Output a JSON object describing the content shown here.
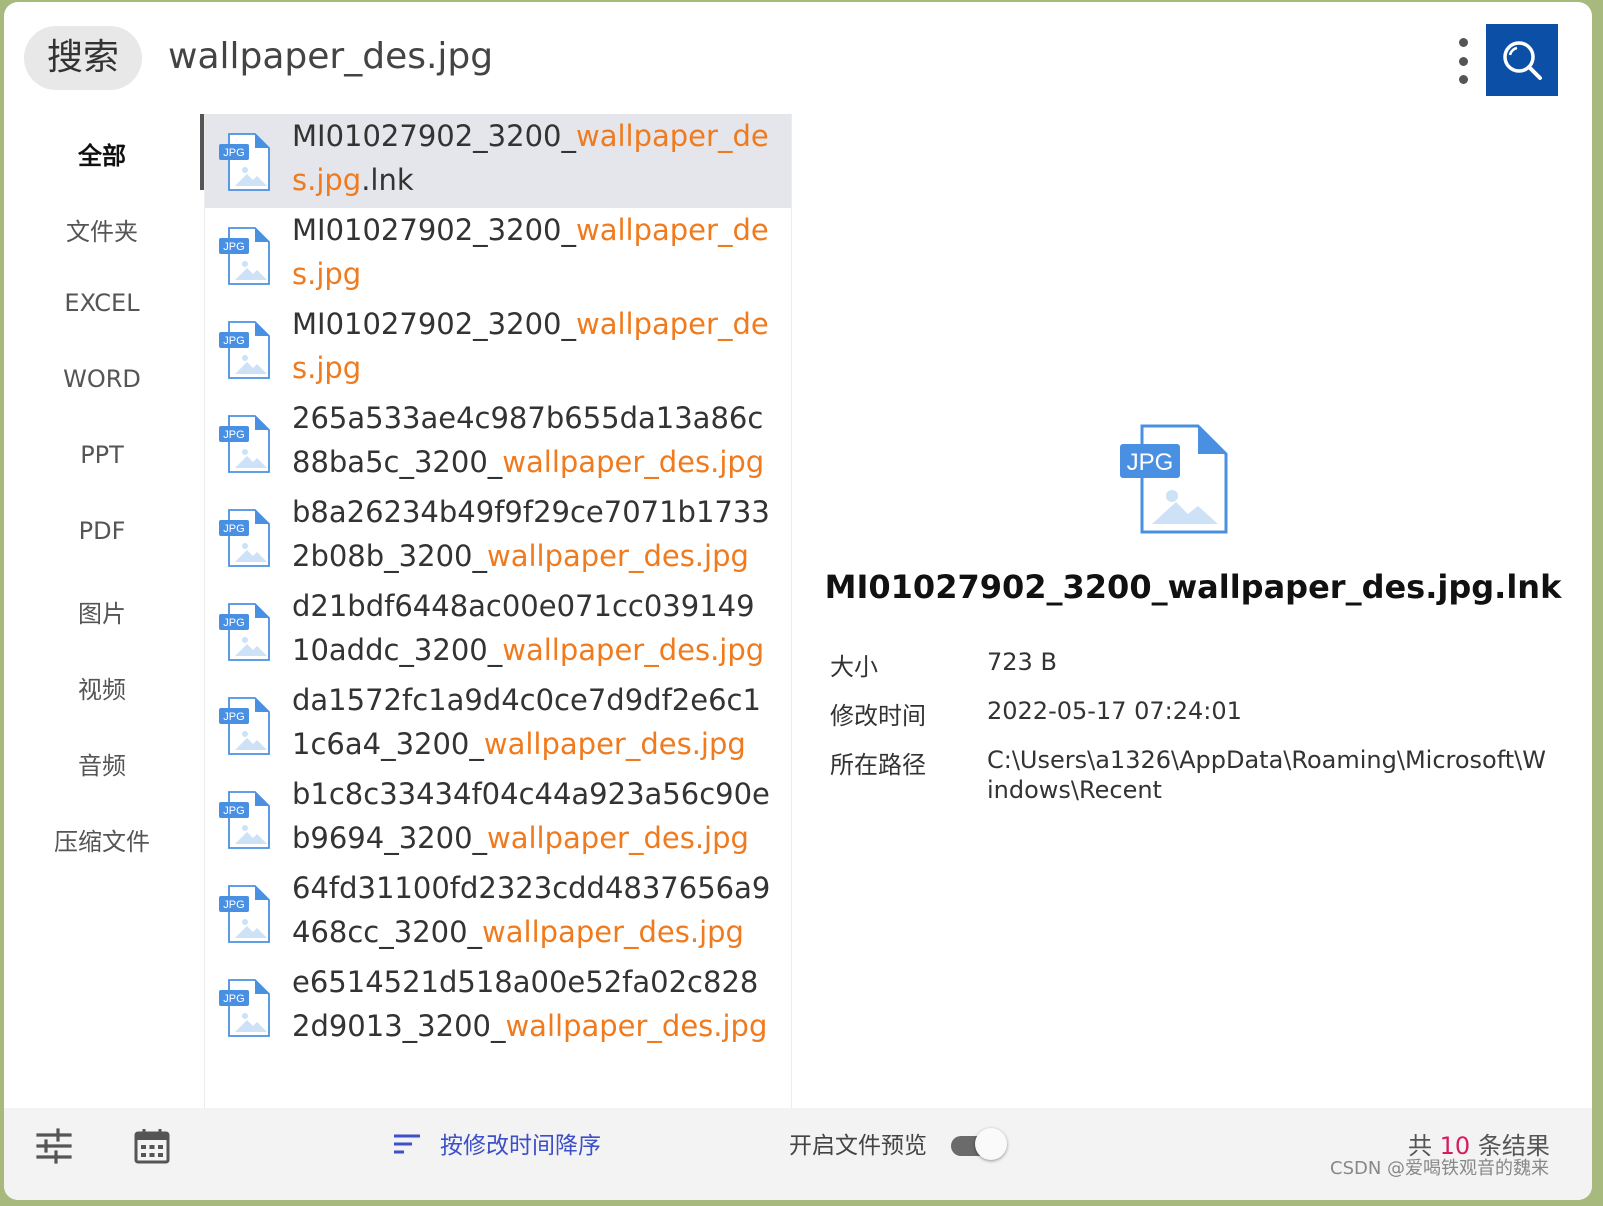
{
  "search": {
    "chip_label": "搜索",
    "query": "wallpaper_des.jpg"
  },
  "sidebar": {
    "items": [
      {
        "label": "全部",
        "active": true
      },
      {
        "label": "文件夹"
      },
      {
        "label": "EXCEL"
      },
      {
        "label": "WORD"
      },
      {
        "label": "PPT"
      },
      {
        "label": "PDF"
      },
      {
        "label": "图片"
      },
      {
        "label": "视频"
      },
      {
        "label": "音频"
      },
      {
        "label": "压缩文件"
      }
    ]
  },
  "file_icon_label": "JPG",
  "results": [
    {
      "prefix": "MI01027902_3200_",
      "match": "wallpaper_des.jpg",
      "suffix": ".lnk",
      "selected": true
    },
    {
      "prefix": "MI01027902_3200_",
      "match": "wallpaper_des.jpg",
      "suffix": ""
    },
    {
      "prefix": "MI01027902_3200_",
      "match": "wallpaper_des.jpg",
      "suffix": ""
    },
    {
      "prefix": "265a533ae4c987b655da13a86c88ba5c_3200_",
      "match": "wallpaper_des.jpg",
      "suffix": ""
    },
    {
      "prefix": "b8a26234b49f9f29ce7071b17332b08b_3200_",
      "match": "wallpaper_des.jpg",
      "suffix": ""
    },
    {
      "prefix": "d21bdf6448ac00e071cc03914910addc_3200_",
      "match": "wallpaper_des.jpg",
      "suffix": ""
    },
    {
      "prefix": "da1572fc1a9d4c0ce7d9df2e6c11c6a4_3200_",
      "match": "wallpaper_des.jpg",
      "suffix": ""
    },
    {
      "prefix": "b1c8c33434f04c44a923a56c90eb9694_3200_",
      "match": "wallpaper_des.jpg",
      "suffix": ""
    },
    {
      "prefix": "64fd31100fd2323cdd4837656a9468cc_3200_",
      "match": "wallpaper_des.jpg",
      "suffix": ""
    },
    {
      "prefix": "e6514521d518a00e52fa02c8282d9013_3200_",
      "match": "wallpaper_des.jpg",
      "suffix": ""
    }
  ],
  "preview": {
    "icon_label": "JPG",
    "title": "MI01027902_3200_wallpaper_des.jpg.lnk",
    "size_label": "大小",
    "size_value": "723 B",
    "modified_label": "修改时间",
    "modified_value": "2022-05-17 07:24:01",
    "path_label": "所在路径",
    "path_value": "C:\\Users\\a1326\\AppData\\Roaming\\Microsoft\\Windows\\Recent"
  },
  "bottom": {
    "sort_label": "按修改时间降序",
    "preview_toggle_label": "开启文件预览",
    "preview_toggle_on": true,
    "count_prefix": "共",
    "count": "10",
    "count_suffix": "条结果",
    "watermark": "CSDN @爱喝铁观音的魏来"
  },
  "colors": {
    "accent": "#0b4fa6",
    "highlight": "#f07b1e",
    "sort": "#3d4fc9",
    "count": "#d81b60"
  }
}
